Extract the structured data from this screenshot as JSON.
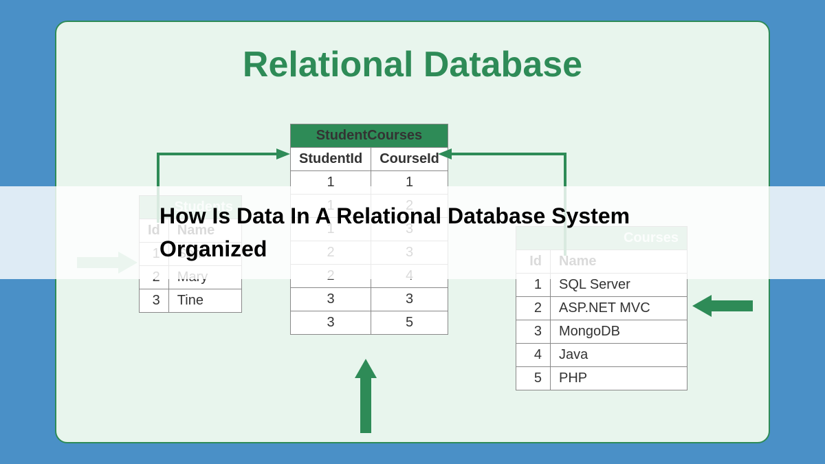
{
  "title": "Relational Database",
  "overlay_text": "How Is Data In A Relational Database System Organized",
  "tables": {
    "students": {
      "title": "Students",
      "columns": [
        "Id",
        "Name"
      ],
      "rows": [
        [
          "1",
          "Sam"
        ],
        [
          "2",
          "Mary"
        ],
        [
          "3",
          "Tine"
        ]
      ]
    },
    "student_courses": {
      "title": "StudentCourses",
      "columns": [
        "StudentId",
        "CourseId"
      ],
      "rows": [
        [
          "1",
          "1"
        ],
        [
          "1",
          "2"
        ],
        [
          "1",
          "3"
        ],
        [
          "2",
          "3"
        ],
        [
          "2",
          "4"
        ],
        [
          "3",
          "3"
        ],
        [
          "3",
          "5"
        ]
      ]
    },
    "courses": {
      "title": "Courses",
      "columns": [
        "Id",
        "Name"
      ],
      "rows": [
        [
          "1",
          "SQL Server"
        ],
        [
          "2",
          "ASP.NET MVC"
        ],
        [
          "3",
          "MongoDB"
        ],
        [
          "4",
          "Java"
        ],
        [
          "5",
          "PHP"
        ]
      ]
    }
  }
}
